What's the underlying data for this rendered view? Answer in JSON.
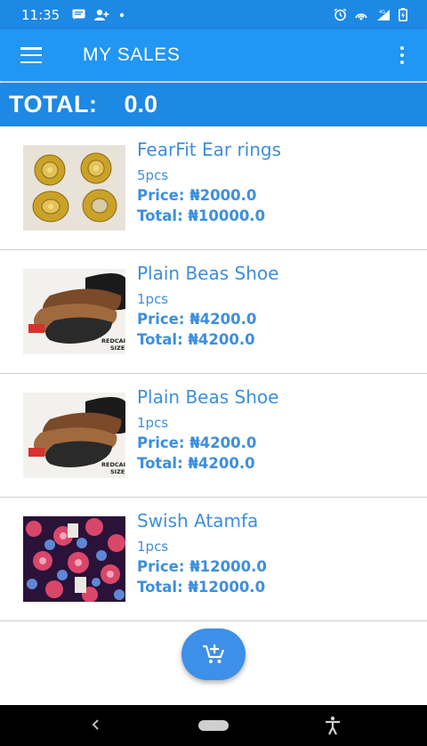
{
  "status_bar": {
    "time": "11:35"
  },
  "app_bar": {
    "title": "MY SALES"
  },
  "summary": {
    "total_label": "TOTAL:",
    "total_value": "0.0"
  },
  "items": [
    {
      "name": "FearFit Ear rings",
      "qty": "5pcs",
      "price": "Price: ₦2000.0",
      "total": "Total: ₦10000.0",
      "image": "earrings"
    },
    {
      "name": "Plain Beas Shoe",
      "qty": "1pcs",
      "price": "Price: ₦4200.0",
      "total": "Total: ₦4200.0",
      "image": "slippers",
      "image_caption": "REDCAI SIZE"
    },
    {
      "name": "Plain Beas Shoe",
      "qty": "1pcs",
      "price": "Price: ₦4200.0",
      "total": "Total: ₦4200.0",
      "image": "slippers",
      "image_caption": "REDCAI SIZE"
    },
    {
      "name": "Swish Atamfa",
      "qty": "1pcs",
      "price": "Price: ₦12000.0",
      "total": "Total: ₦12000.0",
      "image": "fabric"
    }
  ],
  "fab": {
    "icon": "add-shopping-cart-icon"
  },
  "colors": {
    "primary": "#2196f3",
    "primary_dark": "#1e88e5",
    "text_accent": "#3d8fde",
    "fab": "#3d8fe8"
  }
}
